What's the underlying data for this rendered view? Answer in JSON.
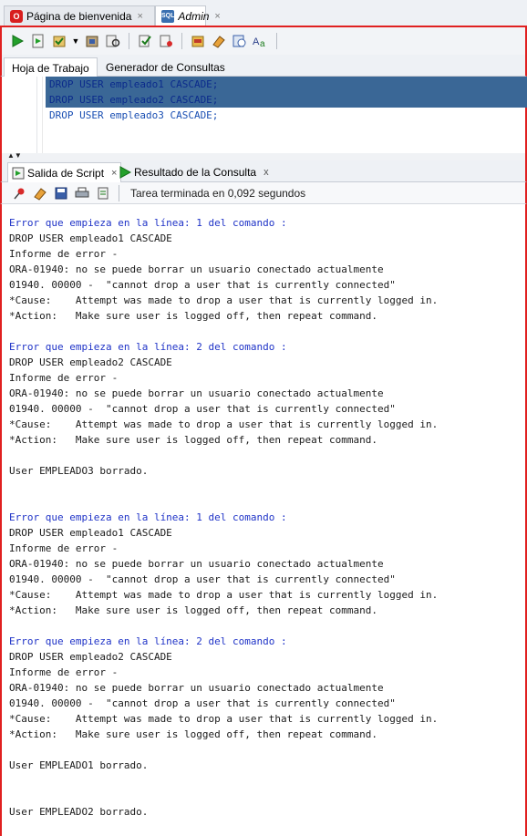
{
  "doc_tabs": [
    {
      "label": "Página de bienvenida",
      "close": "×"
    },
    {
      "label": "Admin",
      "icon": "SQL",
      "close": "×"
    }
  ],
  "sub_tabs": [
    "Hoja de Trabajo",
    "Generador de Consultas"
  ],
  "editor_lines": [
    "DROP USER empleado1 CASCADE;",
    "DROP USER empleado2 CASCADE;",
    "DROP USER empleado3 CASCADE;"
  ],
  "output_tabs": [
    {
      "label": "Salida de Script",
      "close": "×"
    },
    {
      "label": "Resultado de la Consulta",
      "close": "x"
    }
  ],
  "status": "Tarea terminada en 0,092 segundos",
  "output_lines": [
    {
      "text": "Error que empieza en la línea: 1 del comando :",
      "type": "err"
    },
    {
      "text": "DROP USER empleado1 CASCADE",
      "type": "txt"
    },
    {
      "text": "Informe de error -",
      "type": "txt"
    },
    {
      "text": "ORA-01940: no se puede borrar un usuario conectado actualmente",
      "type": "txt"
    },
    {
      "text": "01940. 00000 -  \"cannot drop a user that is currently connected\"",
      "type": "txt"
    },
    {
      "text": "*Cause:    Attempt was made to drop a user that is currently logged in.",
      "type": "txt"
    },
    {
      "text": "*Action:   Make sure user is logged off, then repeat command.",
      "type": "txt"
    },
    {
      "text": "",
      "type": "txt"
    },
    {
      "text": "Error que empieza en la línea: 2 del comando :",
      "type": "err"
    },
    {
      "text": "DROP USER empleado2 CASCADE",
      "type": "txt"
    },
    {
      "text": "Informe de error -",
      "type": "txt"
    },
    {
      "text": "ORA-01940: no se puede borrar un usuario conectado actualmente",
      "type": "txt"
    },
    {
      "text": "01940. 00000 -  \"cannot drop a user that is currently connected\"",
      "type": "txt"
    },
    {
      "text": "*Cause:    Attempt was made to drop a user that is currently logged in.",
      "type": "txt"
    },
    {
      "text": "*Action:   Make sure user is logged off, then repeat command.",
      "type": "txt"
    },
    {
      "text": "",
      "type": "txt"
    },
    {
      "text": "User EMPLEADO3 borrado.",
      "type": "txt"
    },
    {
      "text": "",
      "type": "txt"
    },
    {
      "text": "",
      "type": "txt"
    },
    {
      "text": "Error que empieza en la línea: 1 del comando :",
      "type": "err"
    },
    {
      "text": "DROP USER empleado1 CASCADE",
      "type": "txt"
    },
    {
      "text": "Informe de error -",
      "type": "txt"
    },
    {
      "text": "ORA-01940: no se puede borrar un usuario conectado actualmente",
      "type": "txt"
    },
    {
      "text": "01940. 00000 -  \"cannot drop a user that is currently connected\"",
      "type": "txt"
    },
    {
      "text": "*Cause:    Attempt was made to drop a user that is currently logged in.",
      "type": "txt"
    },
    {
      "text": "*Action:   Make sure user is logged off, then repeat command.",
      "type": "txt"
    },
    {
      "text": "",
      "type": "txt"
    },
    {
      "text": "Error que empieza en la línea: 2 del comando :",
      "type": "err"
    },
    {
      "text": "DROP USER empleado2 CASCADE",
      "type": "txt"
    },
    {
      "text": "Informe de error -",
      "type": "txt"
    },
    {
      "text": "ORA-01940: no se puede borrar un usuario conectado actualmente",
      "type": "txt"
    },
    {
      "text": "01940. 00000 -  \"cannot drop a user that is currently connected\"",
      "type": "txt"
    },
    {
      "text": "*Cause:    Attempt was made to drop a user that is currently logged in.",
      "type": "txt"
    },
    {
      "text": "*Action:   Make sure user is logged off, then repeat command.",
      "type": "txt"
    },
    {
      "text": "",
      "type": "txt"
    },
    {
      "text": "User EMPLEADO1 borrado.",
      "type": "txt"
    },
    {
      "text": "",
      "type": "txt"
    },
    {
      "text": "",
      "type": "txt"
    },
    {
      "text": "User EMPLEADO2 borrado.",
      "type": "txt"
    }
  ],
  "colors": {
    "accent_border": "#e02020",
    "selection": "#3a6796",
    "keyword": "#1a4fb3",
    "error_header": "#1f33c7"
  }
}
